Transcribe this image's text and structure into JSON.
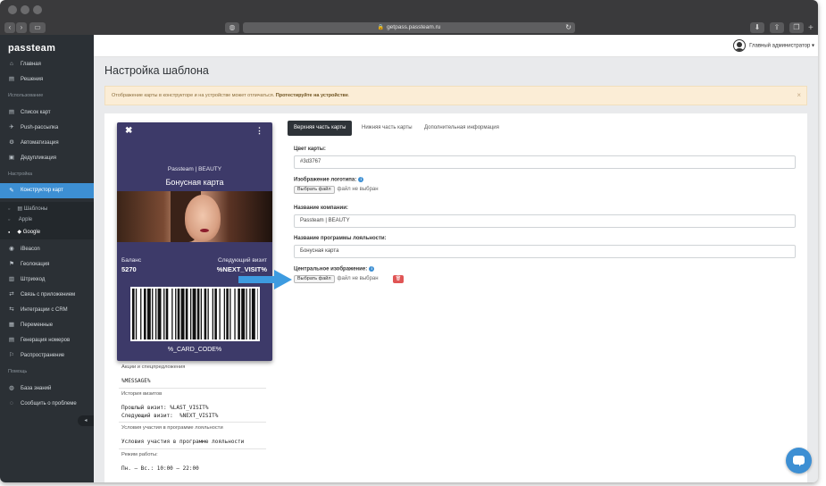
{
  "browser": {
    "url": "getpass.passteam.ru",
    "lock_icon": "lock-icon",
    "reload_icon": "reload-icon"
  },
  "sidebar": {
    "logo": "passteam",
    "items_top": [
      {
        "label": "Главная",
        "icon": "home-icon",
        "glyph": "⌂"
      },
      {
        "label": "Решения",
        "icon": "list-icon",
        "glyph": "▤"
      }
    ],
    "section_use": "Использование",
    "items_use": [
      {
        "label": "Список карт",
        "icon": "cards-icon",
        "glyph": "▤"
      },
      {
        "label": "Push-рассылка",
        "icon": "push-icon",
        "glyph": "✈"
      },
      {
        "label": "Автоматизация",
        "icon": "automation-icon",
        "glyph": "⚙"
      },
      {
        "label": "Дедупликация",
        "icon": "dedup-icon",
        "glyph": "▣"
      }
    ],
    "section_settings": "Настройка",
    "active_item": {
      "label": "Конструктор карт",
      "icon": "brush-icon",
      "glyph": "✎"
    },
    "subitems": [
      {
        "label": "Шаблоны",
        "prefix": "▤ "
      },
      {
        "label": "Apple",
        "prefix": ""
      },
      {
        "label": "Google",
        "prefix": "◆ "
      }
    ],
    "items_settings": [
      {
        "label": "iBeacon",
        "icon": "beacon-icon",
        "glyph": "◉"
      },
      {
        "label": "Геолокация",
        "icon": "location-icon",
        "glyph": "⚑"
      },
      {
        "label": "Штрихкод",
        "icon": "barcode-icon",
        "glyph": "▥"
      },
      {
        "label": "Связь с приложением",
        "icon": "link-icon",
        "glyph": "⇄"
      },
      {
        "label": "Интеграции с CRM",
        "icon": "integration-icon",
        "glyph": "⇆"
      },
      {
        "label": "Переменные",
        "icon": "variables-icon",
        "glyph": "▦"
      },
      {
        "label": "Генерация номеров",
        "icon": "numbers-icon",
        "glyph": "▤"
      },
      {
        "label": "Распространение",
        "icon": "share-icon",
        "glyph": "⚐"
      }
    ],
    "section_help": "Помощь",
    "items_help": [
      {
        "label": "База знаний",
        "icon": "knowledge-icon",
        "glyph": "◍"
      },
      {
        "label": "Сообщить о проблеме",
        "icon": "report-icon",
        "glyph": "◌"
      }
    ],
    "collapse_glyph": "◂"
  },
  "header": {
    "admin_label": "Главный администратор",
    "dropdown_glyph": "▾"
  },
  "page": {
    "title": "Настройка шаблона",
    "alert_text": "Отображение карты в конструкторе и на устройстве может отличаться. ",
    "alert_bold": "Протестируйте на устройстве",
    "alert_end": ".",
    "alert_close": "×"
  },
  "card": {
    "close_glyph": "✖",
    "menu_glyph": "⋮",
    "company": "Passteam | BEAUTY",
    "program": "Бонусная карта",
    "balance_label": "Баланс",
    "balance_value": "5270",
    "next_visit_label": "Следующий визит",
    "next_visit_value": "%NEXT_VISIT%",
    "code": "%_CARD_CODE%"
  },
  "back_fields": [
    {
      "label": "Акции и спецпредложения",
      "value": "%MESSAGE%"
    },
    {
      "label": "История визитов",
      "value": "Прошлый визит: %LAST_VISIT%\nСледующий визит:  %NEXT_VISIT%"
    },
    {
      "label": "Условия участия в программе лояльности",
      "value": "Условия участия в программе лояльности"
    },
    {
      "label": "Режим работы:",
      "value": "Пн. — Вс.: 10:00 — 22:00"
    }
  ],
  "tabs": [
    {
      "label": "Верхняя часть карты",
      "active": true
    },
    {
      "label": "Нижняя часть карты",
      "active": false
    },
    {
      "label": "Дополнительная информация",
      "active": false
    }
  ],
  "form": {
    "card_color_label": "Цвет карты:",
    "card_color_value": "#3d3767",
    "logo_label": "Изображение логотипа:",
    "choose_file": "Выбрать файл",
    "no_file": "файл не выбран",
    "company_label": "Название компании:",
    "company_value": "Passteam | BEAUTY",
    "program_label": "Название программы лояльности:",
    "program_value": "Бонусная карта",
    "central_image_label": "Центральное изображение:",
    "info_glyph": "i",
    "delete_glyph": "🗑"
  },
  "colors": {
    "accent": "#3d8fd3",
    "sidebar": "#2b3035",
    "card_bg": "#3d3a69",
    "danger": "#e05555"
  }
}
